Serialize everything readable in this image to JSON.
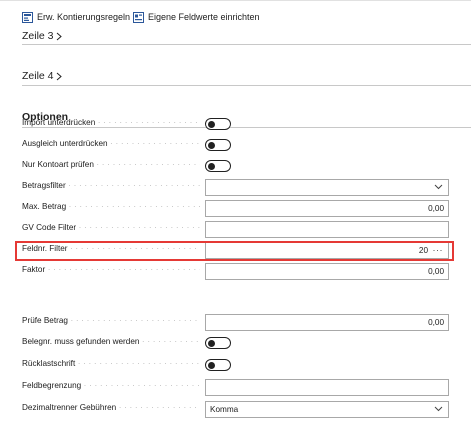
{
  "toolbar": {
    "advanced_posting_rules": "Erw. Kontierungsregeln",
    "own_field_values": "Eigene Feldwerte einrichten"
  },
  "sections": {
    "line3": "Zeile 3",
    "line4": "Zeile 4",
    "options": "Optionen"
  },
  "fields": {
    "import_suppress": {
      "label": "Import unterdrücken",
      "type": "toggle",
      "value": false
    },
    "balance_suppress": {
      "label": "Ausgleich unterdrücken",
      "type": "toggle",
      "value": false
    },
    "check_account_type": {
      "label": "Nur Kontoart prüfen",
      "type": "toggle",
      "value": false
    },
    "amount_filter": {
      "label": "Betragsfilter",
      "type": "select",
      "value": ""
    },
    "max_amount": {
      "label": "Max. Betrag",
      "type": "text",
      "value": "0,00"
    },
    "gv_code_filter": {
      "label": "GV Code Filter",
      "type": "text",
      "value": ""
    },
    "field_no_filter": {
      "label": "Feldnr. Filter",
      "type": "lookup",
      "value": "20"
    },
    "factor": {
      "label": "Faktor",
      "type": "text",
      "value": "0,00"
    },
    "check_amount": {
      "label": "Prüfe Betrag",
      "type": "text",
      "value": "0,00"
    },
    "doc_no_must_be_found": {
      "label": "Belegnr. muss gefunden werden",
      "type": "toggle",
      "value": false
    },
    "return_debit": {
      "label": "Rücklastschrift",
      "type": "toggle",
      "value": false
    },
    "field_delimiter": {
      "label": "Feldbegrenzung",
      "type": "text",
      "value": ""
    },
    "decimal_separator_fees": {
      "label": "Dezimaltrenner Gebühren",
      "type": "select",
      "value": "Komma"
    }
  },
  "colors": {
    "highlight": "#e53935",
    "accent": "#0078d4"
  }
}
